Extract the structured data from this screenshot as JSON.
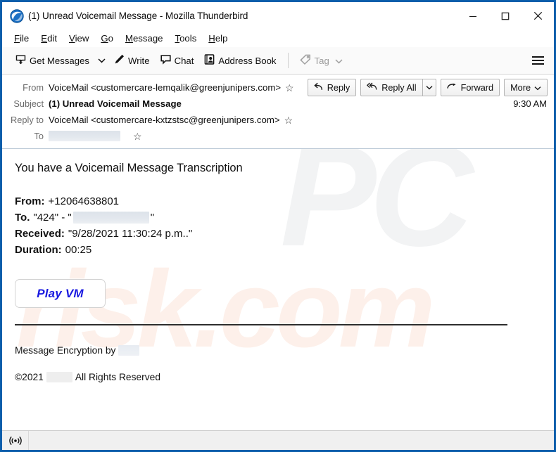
{
  "window": {
    "title": "(1) Unread Voicemail Message - Mozilla Thunderbird",
    "app_icon": "thunderbird-icon",
    "border_color": "#0b5eab",
    "controls": {
      "minimize": "minimize-icon",
      "maximize": "maximize-icon",
      "close": "close-icon"
    }
  },
  "menubar": {
    "items": [
      {
        "label": "File",
        "accesskey": "F"
      },
      {
        "label": "Edit",
        "accesskey": "E"
      },
      {
        "label": "View",
        "accesskey": "V"
      },
      {
        "label": "Go",
        "accesskey": "G"
      },
      {
        "label": "Message",
        "accesskey": "M"
      },
      {
        "label": "Tools",
        "accesskey": "T"
      },
      {
        "label": "Help",
        "accesskey": "H"
      }
    ]
  },
  "toolbar": {
    "get_messages": "Get Messages",
    "get_messages_icon": "download-mail-icon",
    "get_messages_caret": "chevron-down-icon",
    "write": "Write",
    "write_icon": "pencil-icon",
    "chat": "Chat",
    "chat_icon": "speech-bubble-icon",
    "address_book": "Address Book",
    "address_book_icon": "address-book-icon",
    "tag": "Tag",
    "tag_icon": "tag-icon",
    "tag_caret": "chevron-down-icon",
    "tag_disabled": true,
    "app_menu_icon": "hamburger-menu-icon"
  },
  "message_header": {
    "rows": [
      {
        "label": "From",
        "value": "VoiceMail <customercare-lemqalik@greenjunipers.com>",
        "star": true,
        "bold": false
      },
      {
        "label": "Subject",
        "value": "(1) Unread Voicemail Message",
        "star": false,
        "bold": true
      },
      {
        "label": "Reply to",
        "value": "VoiceMail <customercare-kxtzstsc@greenjunipers.com>",
        "star": true,
        "bold": false
      },
      {
        "label": "To",
        "value": "",
        "redacted": true,
        "redacted_width": 102,
        "star": true,
        "bold": false
      }
    ],
    "timestamp": "9:30 AM",
    "actions": {
      "reply": "Reply",
      "reply_icon": "reply-arrow-icon",
      "reply_all": "Reply All",
      "reply_all_icon": "reply-all-arrow-icon",
      "reply_all_caret": "chevron-down-icon",
      "forward": "Forward",
      "forward_icon": "forward-arrow-icon",
      "more": "More",
      "more_caret": "chevron-down-icon"
    }
  },
  "message_body": {
    "title": "You have a Voicemail Message Transcription",
    "details": [
      {
        "key": "From:",
        "value": "+12064638801"
      },
      {
        "key": "To.",
        "value": "\"424\" - \"",
        "redacted": true,
        "redacted_width": 108,
        "value_after": "\""
      },
      {
        "key": "Received:",
        "value": "\"9/28/2021 11:30:24 p.m..\""
      },
      {
        "key": "Duration:",
        "value": "00:25"
      }
    ],
    "play_button": "Play VM",
    "play_button_color": "#1a1ae0",
    "footer_encryption_prefix": "Message Encryption by",
    "footer_encryption_redacted_width": 30,
    "footer_copyright_prefix": "©2021",
    "footer_copyright_redacted_width": 37,
    "footer_copyright_suffix": "All Rights Reserved"
  },
  "watermark": {
    "primary": "PC",
    "secondary": "risk.com"
  },
  "statusbar": {
    "icon": "broadcast-signal-icon",
    "text": ""
  }
}
